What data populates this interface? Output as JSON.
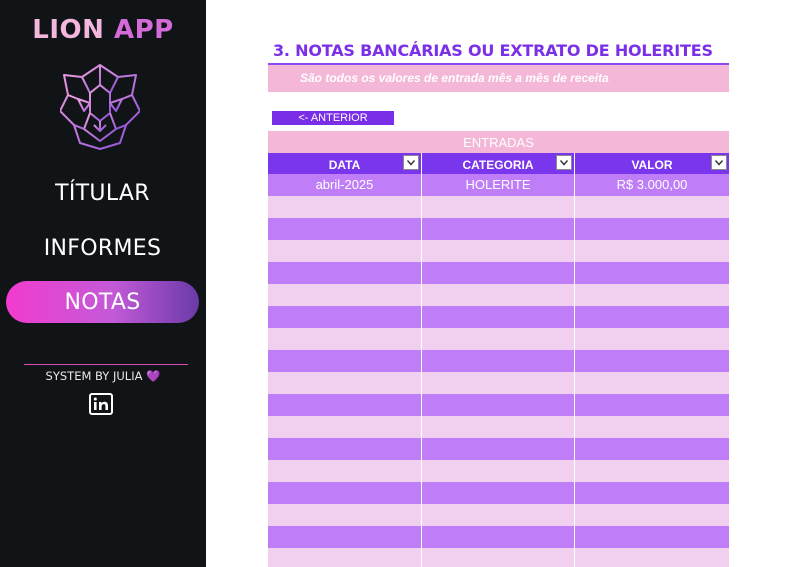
{
  "sidebar": {
    "brand_part1": "LION ",
    "brand_part2": "APP",
    "nav": [
      {
        "label": "TÍTULAR",
        "active": false
      },
      {
        "label": "INFORMES",
        "active": false
      },
      {
        "label": "NOTAS",
        "active": true
      }
    ],
    "credit": "SYSTEM BY JULIA",
    "credit_heart": "💜",
    "logo_icon": "lion-head-icon",
    "linkedin_icon": "linkedin-icon"
  },
  "main": {
    "title": "3. NOTAS BANCÁRIAS OU EXTRATO DE HOLERITES",
    "subtitle": "São todos os valores de entrada mês a mês de receita",
    "back_button": "<- ANTERIOR",
    "table": {
      "caption": "ENTRADAS",
      "columns": [
        "DATA",
        "CATEGORIA",
        "VALOR"
      ],
      "rows": [
        [
          "abril-2025",
          "HOLERITE",
          "R$ 3.000,00"
        ]
      ],
      "empty_row_count": 17
    }
  },
  "colors": {
    "sidebar_bg": "#111417",
    "accent_purple": "#7a2ee8",
    "pink": "#f4b7d7",
    "row_odd": "#bf7ef7",
    "row_even": "#f1cfef"
  }
}
